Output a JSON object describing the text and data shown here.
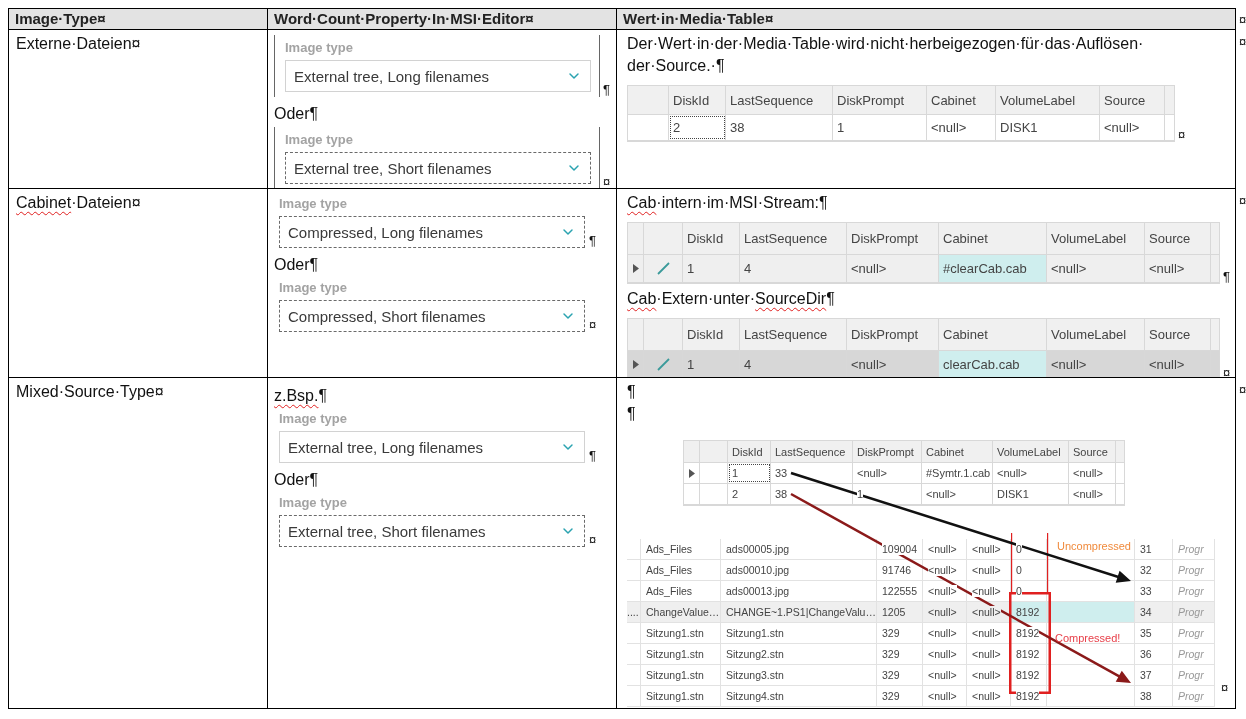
{
  "header": {
    "cells": [
      "Image·Type¤",
      "Word·Count·Property·In·MSI·Editor¤",
      "Wert·in·Media·Table¤"
    ],
    "end_mark": "¤"
  },
  "rows": [
    {
      "type": [
        {
          "text": "Externe·Dateien¤",
          "misspelled": false
        }
      ],
      "end_mark": "¤",
      "editor": [
        {
          "kind": "dropdown",
          "label": "Image type",
          "value": "External tree, Long filenames",
          "focused": false,
          "bracketed": true,
          "mark": "¶"
        },
        {
          "kind": "text",
          "segments": [
            {
              "text": "Oder¶",
              "misspelled": false
            }
          ]
        },
        {
          "kind": "dropdown",
          "label": "Image type",
          "value": "External tree, Short filenames",
          "focused": true,
          "bracketed": true,
          "mark": "¤"
        }
      ],
      "media": [
        {
          "kind": "text",
          "segments": [
            {
              "text": "Der·Wert·in·der·Media·Table·wird·nicht·herbeigezogen·für·das·Auflösen·der·Source.·¶",
              "misspelled": false
            }
          ]
        },
        {
          "kind": "grid",
          "mark": "¤",
          "columns": [
            "DiskId",
            "LastSequence",
            "DiskPrompt",
            "Cabinet",
            "VolumeLabel",
            "Source"
          ],
          "rows": [
            {
              "selected": false,
              "cells": [
                {
                  "text": "2",
                  "focused": true
                },
                {
                  "text": "38",
                  "focused": false
                },
                {
                  "text": "1",
                  "focused": false
                },
                {
                  "text": "<null>",
                  "focused": false
                },
                {
                  "text": "DISK1",
                  "focused": false
                },
                {
                  "text": "<null>",
                  "focused": false
                }
              ]
            }
          ]
        }
      ]
    },
    {
      "type": [
        {
          "text": "Cabinet",
          "misspelled": true
        },
        {
          "text": "·Dateien¤",
          "misspelled": false
        }
      ],
      "end_mark": "¤",
      "editor": [
        {
          "kind": "dropdown",
          "label": "Image type",
          "value": "Compressed, Long filenames",
          "focused": true,
          "bracketed": false,
          "mark": "¶"
        },
        {
          "kind": "text",
          "segments": [
            {
              "text": "Oder¶",
              "misspelled": false
            }
          ]
        },
        {
          "kind": "dropdown",
          "label": "Image type",
          "value": "Compressed, Short filenames",
          "focused": true,
          "bracketed": false,
          "mark": "¤"
        }
      ],
      "media": [
        {
          "kind": "text",
          "segments": [
            {
              "text": "Cab",
              "misspelled": true
            },
            {
              "text": "·intern·im·MSI·Stream:¶",
              "misspelled": false
            }
          ]
        },
        {
          "kind": "grid",
          "mark": "¶",
          "columns": [
            "DiskId",
            "LastSequence",
            "DiskPrompt",
            "Cabinet",
            "VolumeLabel",
            "Source"
          ],
          "rows": [
            {
              "current": true,
              "editing": true,
              "selected": true,
              "inactive": false,
              "cells": [
                {
                  "text": "1",
                  "highlighted": false
                },
                {
                  "text": "4",
                  "highlighted": false
                },
                {
                  "text": "<null>",
                  "highlighted": false
                },
                {
                  "text": "#clearCab.cab",
                  "highlighted": true
                },
                {
                  "text": "<null>",
                  "highlighted": false
                },
                {
                  "text": "<null>",
                  "highlighted": false
                }
              ]
            }
          ]
        },
        {
          "kind": "text",
          "segments": [
            {
              "text": "Cab",
              "misspelled": true
            },
            {
              "text": "·Extern·unter·",
              "misspelled": false
            },
            {
              "text": "SourceDir",
              "misspelled": true
            },
            {
              "text": "¶",
              "misspelled": false
            }
          ]
        },
        {
          "kind": "grid",
          "mark": "¤",
          "columns": [
            "DiskId",
            "LastSequence",
            "DiskPrompt",
            "Cabinet",
            "VolumeLabel",
            "Source"
          ],
          "rows": [
            {
              "current": true,
              "editing": true,
              "selected": true,
              "inactive": true,
              "cells": [
                {
                  "text": "1",
                  "highlighted": false
                },
                {
                  "text": "4",
                  "highlighted": false
                },
                {
                  "text": "<null>",
                  "highlighted": false
                },
                {
                  "text": "clearCab.cab",
                  "highlighted": true
                },
                {
                  "text": "<null>",
                  "highlighted": false
                },
                {
                  "text": "<null>",
                  "highlighted": false
                }
              ]
            }
          ]
        }
      ]
    },
    {
      "type": [
        {
          "text": "Mixed·Source·Type¤",
          "misspelled": false
        }
      ],
      "end_mark": "¤",
      "editor": [
        {
          "kind": "text",
          "segments": [
            {
              "text": "z.Bsp.",
              "misspelled": true
            },
            {
              "text": "¶",
              "misspelled": false
            }
          ]
        },
        {
          "kind": "dropdown",
          "label": "Image type",
          "value": "External tree, Long filenames",
          "focused": false,
          "bracketed": false,
          "mark": "¶"
        },
        {
          "kind": "text",
          "segments": [
            {
              "text": "Oder¶",
              "misspelled": false
            }
          ]
        },
        {
          "kind": "dropdown",
          "label": "Image type",
          "value": "External tree, Short filenames",
          "focused": true,
          "bracketed": false,
          "mark": "¤"
        }
      ],
      "media": [
        {
          "kind": "text",
          "segments": [
            {
              "text": "¶",
              "misspelled": false
            }
          ]
        },
        {
          "kind": "text",
          "segments": [
            {
              "text": "¶",
              "misspelled": false
            }
          ]
        },
        {
          "kind": "screenshot",
          "mark": "¤",
          "media_grid": {
            "columns": [
              "DiskId",
              "LastSequence",
              "DiskPrompt",
              "Cabinet",
              "VolumeLabel",
              "Source"
            ],
            "rows": [
              {
                "current": true,
                "selected": false,
                "cells": [
                  {
                    "text": "1",
                    "focused": true
                  },
                  {
                    "text": "33",
                    "focused": false
                  },
                  {
                    "text": "<null>",
                    "focused": false
                  },
                  {
                    "text": "#Symtr.1.cab",
                    "focused": false
                  },
                  {
                    "text": "<null>",
                    "focused": false
                  },
                  {
                    "text": "<null>",
                    "focused": false
                  }
                ]
              },
              {
                "current": false,
                "selected": false,
                "cells": [
                  {
                    "text": "2",
                    "focused": false
                  },
                  {
                    "text": "38",
                    "focused": false
                  },
                  {
                    "text": "1",
                    "focused": false
                  },
                  {
                    "text": "<null>",
                    "focused": false
                  },
                  {
                    "text": "DISK1",
                    "focused": false
                  },
                  {
                    "text": "<null>",
                    "focused": false
                  }
                ]
              }
            ]
          },
          "file_rows": [
            {
              "selected": false,
              "gap_highlighted": false,
              "cells": [
                {
                  "text": "Ads_Files",
                  "highlighted": false
                },
                {
                  "text": "ads00005.jpg",
                  "highlighted": false
                },
                {
                  "text": "109004",
                  "highlighted": false
                },
                {
                  "text": "<null>",
                  "highlighted": false
                },
                {
                  "text": "<null>",
                  "highlighted": false
                },
                {
                  "text": "0",
                  "highlighted": false
                },
                {
                  "text": "31",
                  "highlighted": false
                },
                {
                  "text": "Progr",
                  "highlighted": false
                }
              ]
            },
            {
              "selected": false,
              "gap_highlighted": false,
              "cells": [
                {
                  "text": "Ads_Files",
                  "highlighted": false
                },
                {
                  "text": "ads00010.jpg",
                  "highlighted": false
                },
                {
                  "text": "91746",
                  "highlighted": false
                },
                {
                  "text": "<null>",
                  "highlighted": false
                },
                {
                  "text": "<null>",
                  "highlighted": false
                },
                {
                  "text": "0",
                  "highlighted": false
                },
                {
                  "text": "32",
                  "highlighted": false
                },
                {
                  "text": "Progr",
                  "highlighted": false
                }
              ]
            },
            {
              "selected": false,
              "gap_highlighted": false,
              "cells": [
                {
                  "text": "Ads_Files",
                  "highlighted": false
                },
                {
                  "text": "ads00013.jpg",
                  "highlighted": false
                },
                {
                  "text": "122555",
                  "highlighted": false
                },
                {
                  "text": "<null>",
                  "highlighted": false
                },
                {
                  "text": "<null>",
                  "highlighted": false
                },
                {
                  "text": "0",
                  "highlighted": false
                },
                {
                  "text": "33",
                  "highlighted": false
                },
                {
                  "text": "Progr",
                  "highlighted": false
                }
              ]
            },
            {
              "lead": "....",
              "selected": true,
              "gap_highlighted": true,
              "cells": [
                {
                  "text": "ChangeValue…",
                  "highlighted": false
                },
                {
                  "text": "CHANGE~1.PS1|ChangeValu…",
                  "highlighted": false
                },
                {
                  "text": "1205",
                  "highlighted": false
                },
                {
                  "text": "<null>",
                  "highlighted": false
                },
                {
                  "text": "<null>",
                  "highlighted": false
                },
                {
                  "text": "8192",
                  "highlighted": true
                },
                {
                  "text": "34",
                  "highlighted": false
                },
                {
                  "text": "Progr",
                  "highlighted": false
                }
              ]
            },
            {
              "selected": false,
              "gap_highlighted": false,
              "cells": [
                {
                  "text": "Sitzung1.stn",
                  "highlighted": false
                },
                {
                  "text": "Sitzung1.stn",
                  "highlighted": false
                },
                {
                  "text": "329",
                  "highlighted": false
                },
                {
                  "text": "<null>",
                  "highlighted": false
                },
                {
                  "text": "<null>",
                  "highlighted": false
                },
                {
                  "text": "8192",
                  "highlighted": false
                },
                {
                  "text": "35",
                  "highlighted": false
                },
                {
                  "text": "Progr",
                  "highlighted": false
                }
              ]
            },
            {
              "selected": false,
              "gap_highlighted": false,
              "cells": [
                {
                  "text": "Sitzung1.stn",
                  "highlighted": false
                },
                {
                  "text": "Sitzung2.stn",
                  "highlighted": false
                },
                {
                  "text": "329",
                  "highlighted": false
                },
                {
                  "text": "<null>",
                  "highlighted": false
                },
                {
                  "text": "<null>",
                  "highlighted": false
                },
                {
                  "text": "8192",
                  "highlighted": false
                },
                {
                  "text": "36",
                  "highlighted": false
                },
                {
                  "text": "Progr",
                  "highlighted": false
                }
              ]
            },
            {
              "selected": false,
              "gap_highlighted": false,
              "cells": [
                {
                  "text": "Sitzung1.stn",
                  "highlighted": false
                },
                {
                  "text": "Sitzung3.stn",
                  "highlighted": false
                },
                {
                  "text": "329",
                  "highlighted": false
                },
                {
                  "text": "<null>",
                  "highlighted": false
                },
                {
                  "text": "<null>",
                  "highlighted": false
                },
                {
                  "text": "8192",
                  "highlighted": false
                },
                {
                  "text": "37",
                  "highlighted": false
                },
                {
                  "text": "Progr",
                  "highlighted": false
                }
              ]
            },
            {
              "selected": false,
              "gap_highlighted": false,
              "cells": [
                {
                  "text": "Sitzung1.stn",
                  "highlighted": false
                },
                {
                  "text": "Sitzung4.stn",
                  "highlighted": false
                },
                {
                  "text": "329",
                  "highlighted": false
                },
                {
                  "text": "<null>",
                  "highlighted": false
                },
                {
                  "text": "<null>",
                  "highlighted": false
                },
                {
                  "text": "8192",
                  "highlighted": false
                },
                {
                  "text": "38",
                  "highlighted": false
                },
                {
                  "text": "Progr",
                  "highlighted": false
                }
              ]
            }
          ],
          "notes": [
            {
              "text": "Uncompressed",
              "color": "#f08a3c"
            },
            {
              "text": "Compressed!",
              "color": "#e8404a"
            }
          ]
        }
      ]
    }
  ]
}
